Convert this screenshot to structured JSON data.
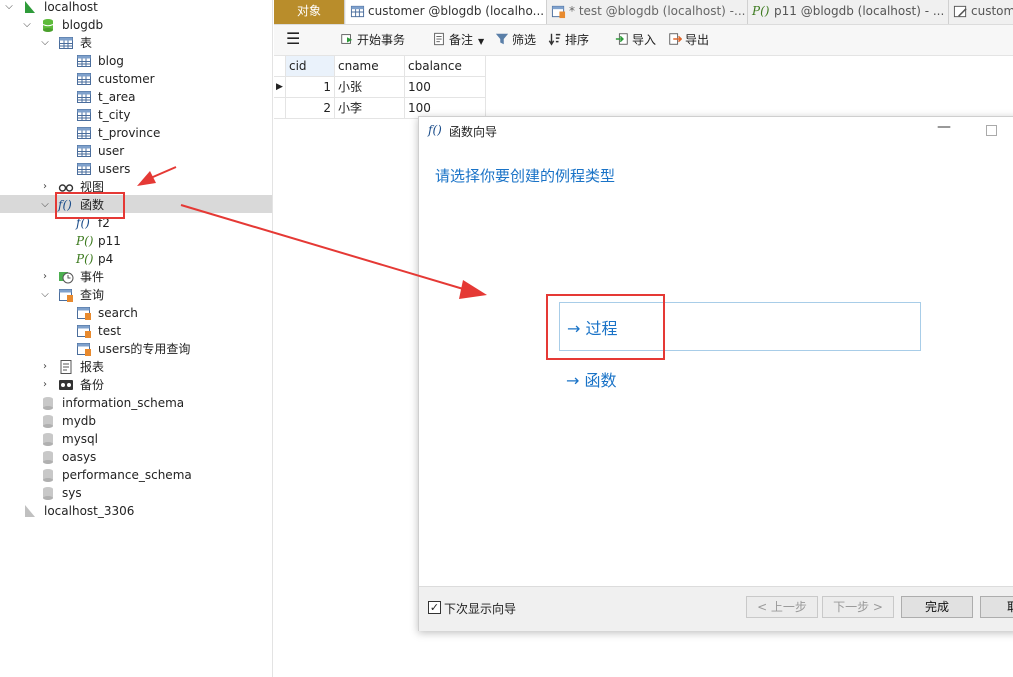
{
  "tree": {
    "connection": "localhost",
    "database": "blogdb",
    "tables_label": "表",
    "tables": [
      "blog",
      "customer",
      "t_area",
      "t_city",
      "t_province",
      "user",
      "users"
    ],
    "views_label": "视图",
    "functions_label": "函数",
    "functions": [
      "f2",
      "p11",
      "p4"
    ],
    "events_label": "事件",
    "queries_label": "查询",
    "queries": [
      "search",
      "test",
      "users的专用查询"
    ],
    "reports_label": "报表",
    "backups_label": "备份",
    "other_dbs": [
      "information_schema",
      "mydb",
      "mysql",
      "oasys",
      "performance_schema",
      "sys"
    ],
    "connection2": "localhost_3306"
  },
  "tabs": {
    "objects": "对象",
    "tab1": "customer @blogdb (localho...",
    "tab2": "* test @blogdb (localhost) -...",
    "tab3": "p11 @blogdb (localhost) - ...",
    "tab4": "custome"
  },
  "toolbar": {
    "begin_tx": "开始事务",
    "note": "备注",
    "filter": "筛选",
    "sort": "排序",
    "import": "导入",
    "export": "导出"
  },
  "grid": {
    "columns": [
      "cid",
      "cname",
      "cbalance"
    ],
    "rows": [
      {
        "cid": "1",
        "cname": "小张",
        "cbalance": "100"
      },
      {
        "cid": "2",
        "cname": "小李",
        "cbalance": "100"
      }
    ]
  },
  "dialog": {
    "title": "函数向导",
    "prompt": "请选择你要创建的例程类型",
    "option_procedure": "→ 过程",
    "option_function": "→ 函数",
    "dont_show": "下次显示向导",
    "dont_show_checked": true,
    "back": "< 上一步",
    "next": "下一步 >",
    "finish": "完成",
    "cancel": "取"
  },
  "colors": {
    "accent_blue": "#1a73c7",
    "annotation_red": "#e53935",
    "objects_tab": "#b98d2b"
  }
}
